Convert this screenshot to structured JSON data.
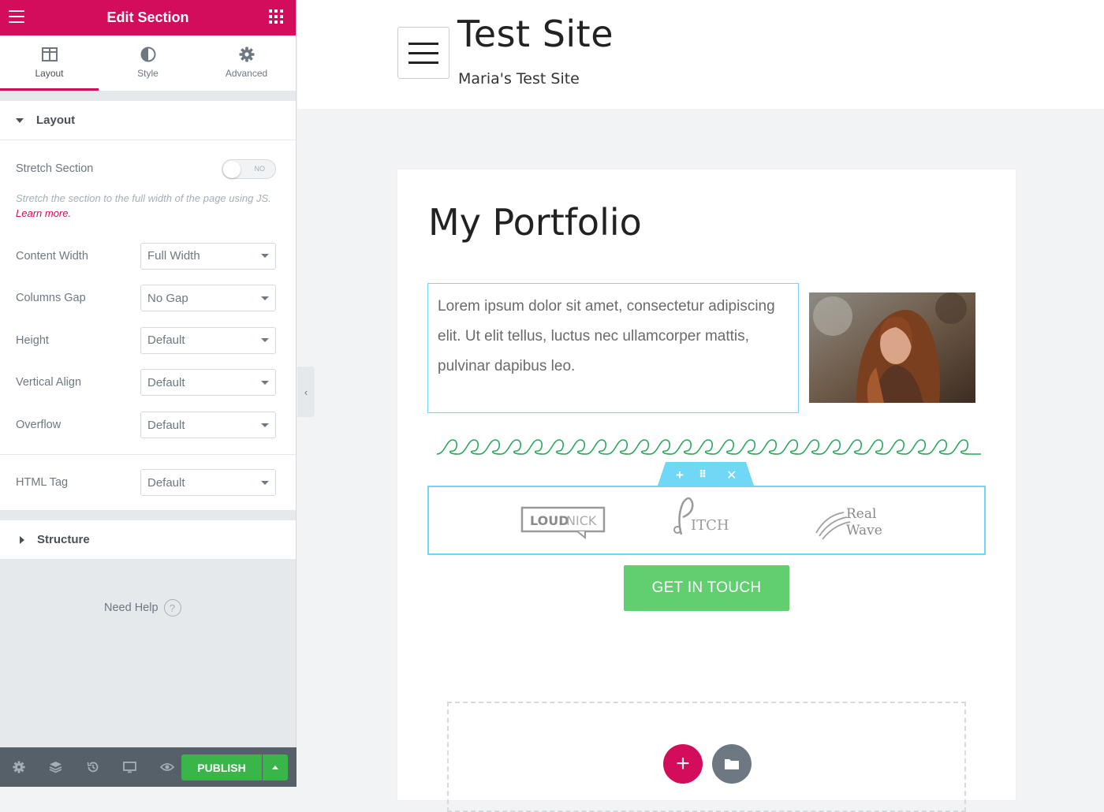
{
  "panel": {
    "header_title": "Edit Section",
    "tabs": [
      {
        "label": "Layout",
        "icon": "columns-icon"
      },
      {
        "label": "Style",
        "icon": "half-circle-icon"
      },
      {
        "label": "Advanced",
        "icon": "gear-icon"
      }
    ],
    "layout_section": {
      "title": "Layout",
      "stretch": {
        "label": "Stretch Section",
        "toggle_text": "NO",
        "description": "Stretch the section to the full width of the page using JS.",
        "learn_more": "Learn more."
      },
      "content_width": {
        "label": "Content Width",
        "value": "Full Width"
      },
      "columns_gap": {
        "label": "Columns Gap",
        "value": "No Gap"
      },
      "height": {
        "label": "Height",
        "value": "Default"
      },
      "vertical_align": {
        "label": "Vertical Align",
        "value": "Default"
      },
      "overflow": {
        "label": "Overflow",
        "value": "Default"
      },
      "html_tag": {
        "label": "HTML Tag",
        "value": "Default"
      }
    },
    "structure_section": {
      "title": "Structure"
    },
    "need_help": "Need Help",
    "footer": {
      "publish_label": "PUBLISH"
    }
  },
  "site": {
    "title": "Test Site",
    "description": "Maria's Test Site"
  },
  "page": {
    "title": "My Portfolio",
    "text": "Lorem ipsum dolor sit amet, consectetur adipiscing elit. Ut elit tellus, luctus nec ullamcorper mattis, pulvinar dapibus leo.",
    "logos": [
      "LOUDNICK",
      "PITCH",
      "Real Wave"
    ],
    "cta_label": "GET IN TOUCH"
  },
  "colors": {
    "brand": "#d30c5c",
    "accent_blue": "#71d7f7",
    "cta_green": "#61ce70",
    "publish_green": "#39b54a"
  }
}
